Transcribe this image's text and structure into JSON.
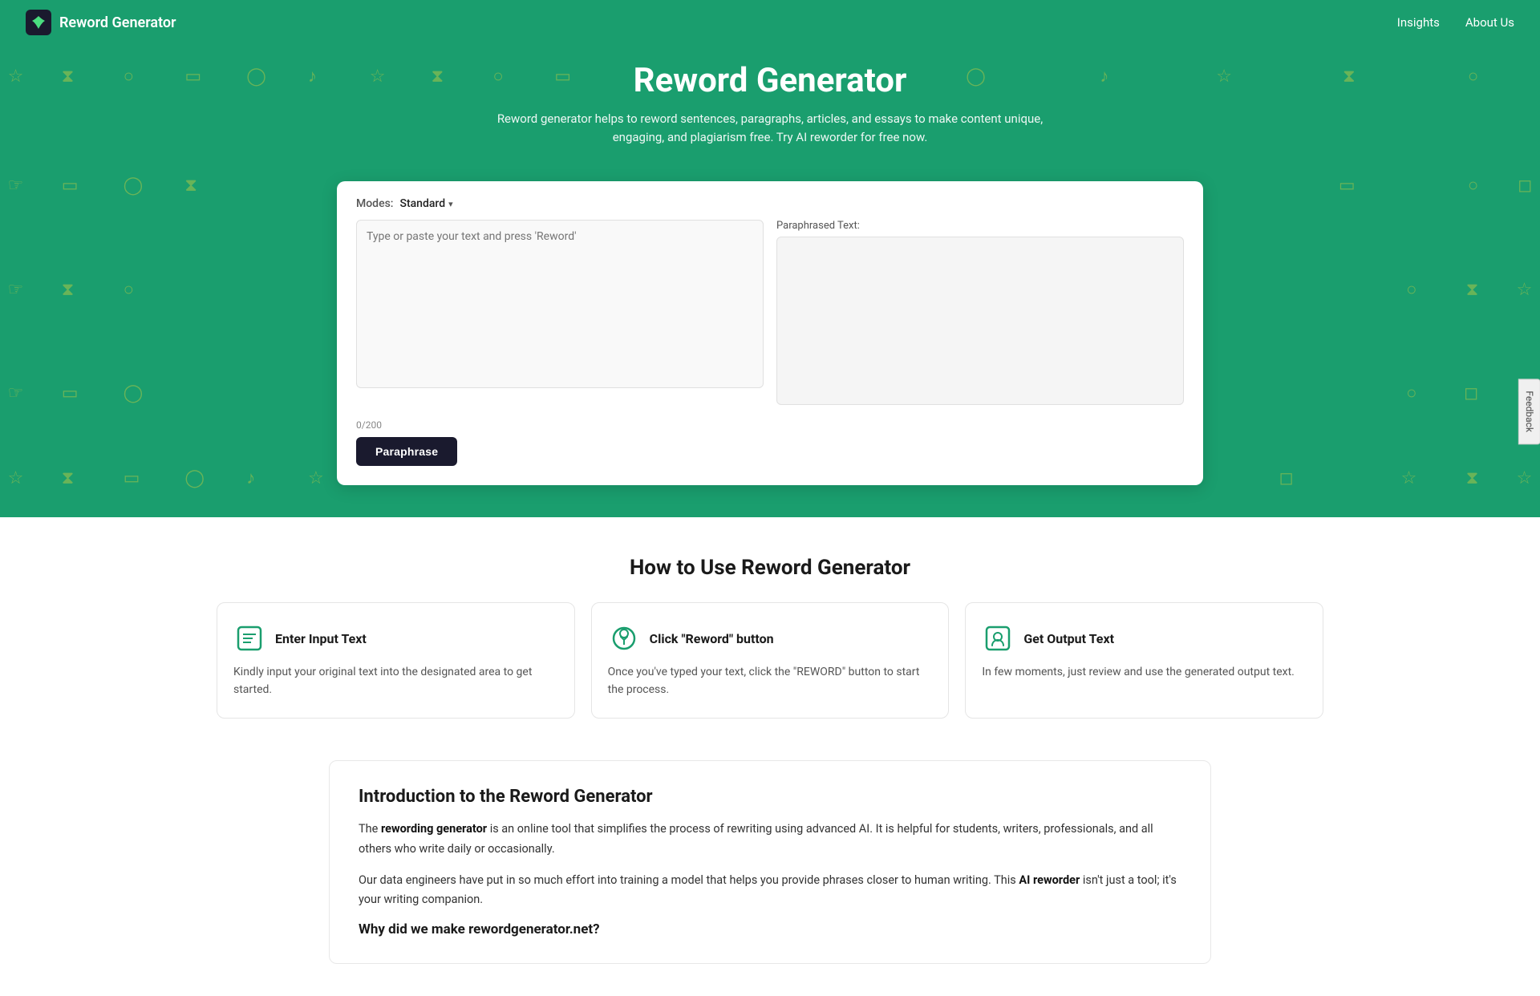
{
  "header": {
    "logo_text": "Reword Generator",
    "logo_icon": "✦",
    "nav": [
      {
        "label": "Insights",
        "href": "#"
      },
      {
        "label": "About Us",
        "href": "#"
      }
    ]
  },
  "hero": {
    "title": "Reword Generator",
    "subtitle": "Reword generator helps to reword sentences, paragraphs, articles, and essays to make content unique, engaging, and plagiarism free. Try AI reworder for free now."
  },
  "tool": {
    "modes_label": "Modes:",
    "selected_mode": "Standard",
    "input_placeholder": "Type or paste your text and press 'Reword'",
    "output_label": "Paraphrased Text:",
    "char_count": "0",
    "char_limit": "/200",
    "paraphrase_button": "Paraphrase"
  },
  "how_to": {
    "title": "How to Use Reword Generator",
    "steps": [
      {
        "icon": "📋",
        "title": "Enter Input Text",
        "description": "Kindly input your original text into the designated area to get started."
      },
      {
        "icon": "🖱️",
        "title": "Click \"Reword\" button",
        "description": "Once you've typed your text, click the \"REWORD\" button to start the process."
      },
      {
        "icon": "📄",
        "title": "Get Output Text",
        "description": "In few moments, just review and use the generated output text."
      }
    ]
  },
  "intro": {
    "title": "Introduction to the Reword Generator",
    "para1_before": "The ",
    "para1_bold1": "rewording generator",
    "para1_middle": " is an online tool that simplifies the process of rewriting using advanced AI. It is helpful for students, writers, professionals, and all others who write daily or occasionally.",
    "para2_before": "Our data engineers have put in so much effort into training a model that helps you provide phrases closer to human writing. This ",
    "para2_bold": "AI reworder",
    "para2_after": " isn't just a tool; it's your writing companion.",
    "sub_heading": "Why did we make rewordgenerator.net?"
  },
  "feedback": {
    "label": "Feedback"
  },
  "bg_icons": [
    "⭐",
    "⏳",
    "🔍",
    "□",
    "💬",
    "🎵",
    "⭐",
    "⏳",
    "🔍",
    "□",
    "💬",
    "🎵",
    "⭐",
    "⏳",
    "🔍",
    "👍",
    "🖥️",
    "🐦",
    "⏳",
    "□",
    "🔍",
    "📷",
    "⭐",
    "⏳",
    "🔍",
    "🔍",
    "⏳",
    "⭐",
    "👍",
    "🖥️",
    "🐦",
    "🔍",
    "📷",
    "⭐",
    "⭐",
    "⏳",
    "□",
    "💬",
    "🎵",
    "⭐",
    "⏳",
    "🔍",
    "📷",
    "⭐",
    "⏳",
    "⭐"
  ]
}
